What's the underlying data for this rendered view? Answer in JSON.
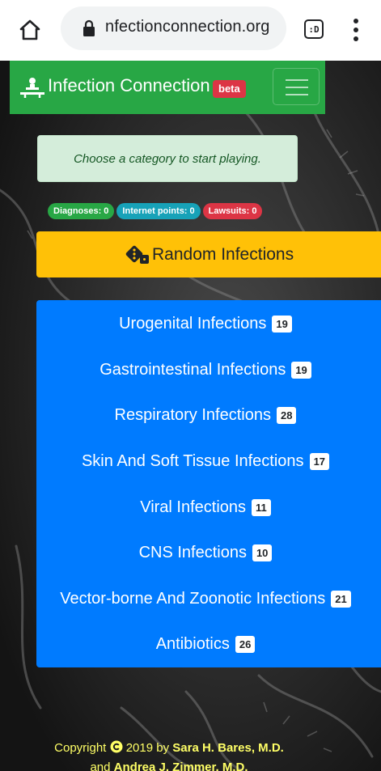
{
  "browser": {
    "url": "nfectionconnection.org",
    "tabs_label": ":D"
  },
  "navbar": {
    "brand": "Infection Connection",
    "badge": "beta"
  },
  "alert": {
    "message": "Choose a category to start playing."
  },
  "stats": [
    {
      "label": "Diagnoses:",
      "value": "0",
      "color": "#28a745"
    },
    {
      "label": "Internet points:",
      "value": "0",
      "color": "#17a2b8"
    },
    {
      "label": "Lawsuits:",
      "value": "0",
      "color": "#dc3545"
    }
  ],
  "random_button": {
    "label": "Random Infections",
    "icon": "dice-icon"
  },
  "categories": [
    {
      "label": "Urogenital Infections",
      "count": "19"
    },
    {
      "label": "Gastrointestinal Infections",
      "count": "19"
    },
    {
      "label": "Respiratory Infections",
      "count": "28"
    },
    {
      "label": "Skin And Soft Tissue Infections",
      "count": "17"
    },
    {
      "label": "Viral Infections",
      "count": "11"
    },
    {
      "label": "CNS Infections",
      "count": "10"
    },
    {
      "label": "Vector-borne And Zoonotic Infections",
      "count": "21"
    },
    {
      "label": "Antibiotics",
      "count": "26"
    }
  ],
  "footer": {
    "prefix": "Copyright",
    "year_text": "2019 by",
    "author1": "Sara H. Bares, M.D.",
    "conjunction": "and",
    "author2": "Andrea J. Zimmer, M.D."
  },
  "colors": {
    "navbar": "#28a745",
    "alert_bg": "#d4edda",
    "random_button": "#ffc107",
    "category_panel": "#007bff",
    "footer_text": "#ffff66"
  }
}
